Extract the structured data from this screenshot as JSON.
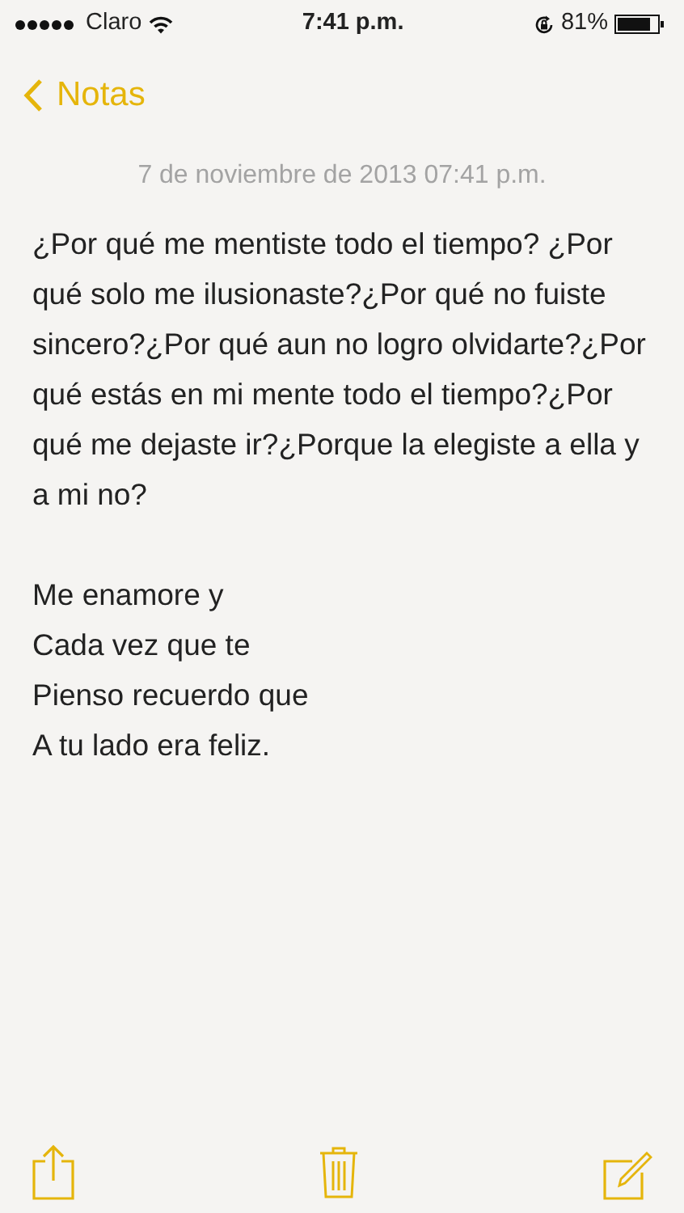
{
  "status_bar": {
    "carrier": "Claro",
    "time": "7:41 p.m.",
    "battery": "81%"
  },
  "nav": {
    "back": "Notas"
  },
  "note": {
    "date": "7 de noviembre de 2013 07:41 p.m.",
    "paragraph": "¿Por qué me mentiste todo el tiempo? ¿Por qué solo me ilusionaste?¿Por qué no fuiste sincero?¿Por qué aun no logro olvidarte?¿Por qué estás en mi mente todo el tiempo?¿Por qué me dejaste ir?¿Porque la elegiste a ella y a mi no?",
    "lines": [
      "Me enamore y",
      "Cada vez que te",
      "Pienso recuerdo que",
      "A tu lado era feliz."
    ]
  }
}
